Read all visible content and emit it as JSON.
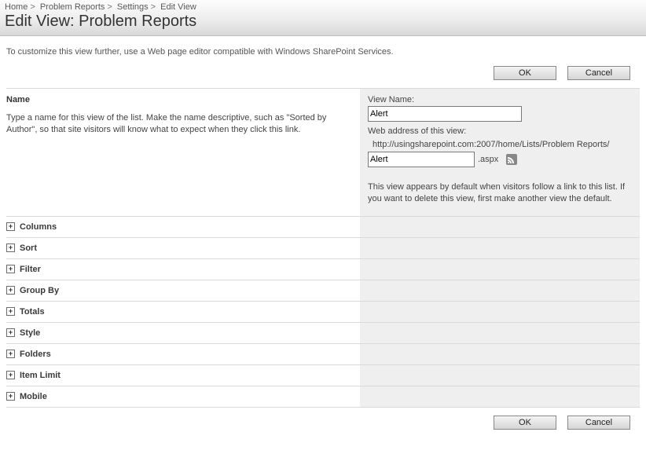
{
  "breadcrumb": {
    "items": [
      "Home",
      "Problem Reports",
      "Settings"
    ],
    "current": "Edit View"
  },
  "page_title": "Edit View: Problem Reports",
  "intro": "To customize this view further, use a Web page editor compatible with Windows SharePoint Services.",
  "buttons": {
    "ok": "OK",
    "cancel": "Cancel"
  },
  "name_section": {
    "heading": "Name",
    "desc": "Type a name for this view of the list. Make the name descriptive, such as \"Sorted by Author\", so that site visitors will know what to expect when they click this link.",
    "view_name_label": "View Name:",
    "view_name_value": "Alert",
    "web_address_label": "Web address of this view:",
    "web_address_prefix": "http://usingsharepoint.com:2007/home/Lists/Problem Reports/",
    "web_address_file": "Alert",
    "web_address_suffix": ".aspx",
    "default_note": "This view appears by default when visitors follow a link to this list. If you want to delete this view, first make another view the default."
  },
  "collapsed_sections": [
    {
      "label": "Columns",
      "name": "columns-section"
    },
    {
      "label": "Sort",
      "name": "sort-section"
    },
    {
      "label": "Filter",
      "name": "filter-section"
    },
    {
      "label": "Group By",
      "name": "groupby-section"
    },
    {
      "label": "Totals",
      "name": "totals-section"
    },
    {
      "label": "Style",
      "name": "style-section"
    },
    {
      "label": "Folders",
      "name": "folders-section"
    },
    {
      "label": "Item Limit",
      "name": "itemlimit-section"
    },
    {
      "label": "Mobile",
      "name": "mobile-section"
    }
  ]
}
